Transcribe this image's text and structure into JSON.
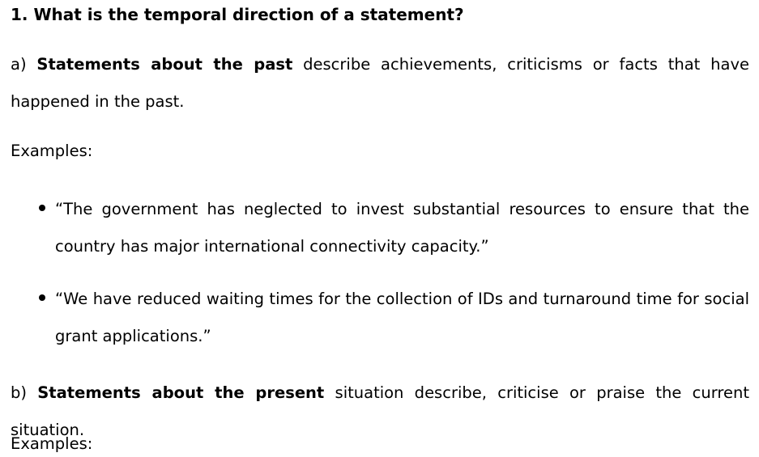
{
  "section": {
    "heading": "1.  What is the temporal direction of a statement?",
    "part_a": {
      "prefix": "a) ",
      "bold": "Statements about the past",
      "rest": " describe achievements, criticisms or facts that have happened in the past."
    },
    "examples_label_a": "Examples:",
    "bullets_a": [
      "“The government has neglected to invest substantial resources to ensure that the country has major international connectivity capacity.”",
      "“We have reduced waiting times for the collection of IDs and turnaround time for social grant applications.”"
    ],
    "part_b": {
      "prefix": "b) ",
      "bold": "Statements about the present",
      "rest": " situation describe, criticise or praise the current situation."
    },
    "examples_label_b": "Examples:"
  }
}
